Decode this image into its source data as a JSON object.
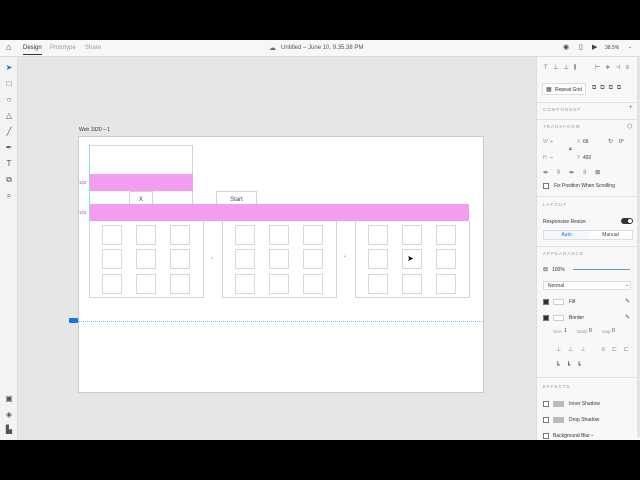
{
  "header": {
    "tabs": [
      "Design",
      "Prototype",
      "Share"
    ],
    "title": "Untitled – June 10, 9.35.38 PM",
    "zoom": "38.5%"
  },
  "canvas": {
    "artboard_label": "Web 1920 – 1",
    "dim_label_1": "102",
    "dim_label_2": "102",
    "button_x": "X",
    "button_start": "Start"
  },
  "panel": {
    "repeat_grid": "Repeat Grid",
    "component": "COMPONENT",
    "transform": "TRANSFORM",
    "w_label": "W",
    "w_val": "–",
    "h_label": "H",
    "h_val": "–",
    "x_label": "X",
    "x_val": "66",
    "y_label": "Y",
    "y_val": "492",
    "rotation": "0°",
    "fix_position": "Fix Position When Scrolling",
    "layout": "LAYOUT",
    "responsive": "Responsive Resize",
    "auto": "Auto",
    "manual": "Manual",
    "appearance": "APPEARANCE",
    "opacity": "100%",
    "opacity_value": 1.0,
    "blend": "Normal",
    "fill": "Fill",
    "border": "Border",
    "size_label": "Size",
    "size_val": "1",
    "dash_label": "Dash",
    "dash_val": "0",
    "gap_label": "Gap",
    "gap_val": "0",
    "effects": "EFFECTS",
    "inner_shadow": "Inner Shadow",
    "drop_shadow": "Drop Shadow",
    "bg_blur": "Background Blur"
  }
}
